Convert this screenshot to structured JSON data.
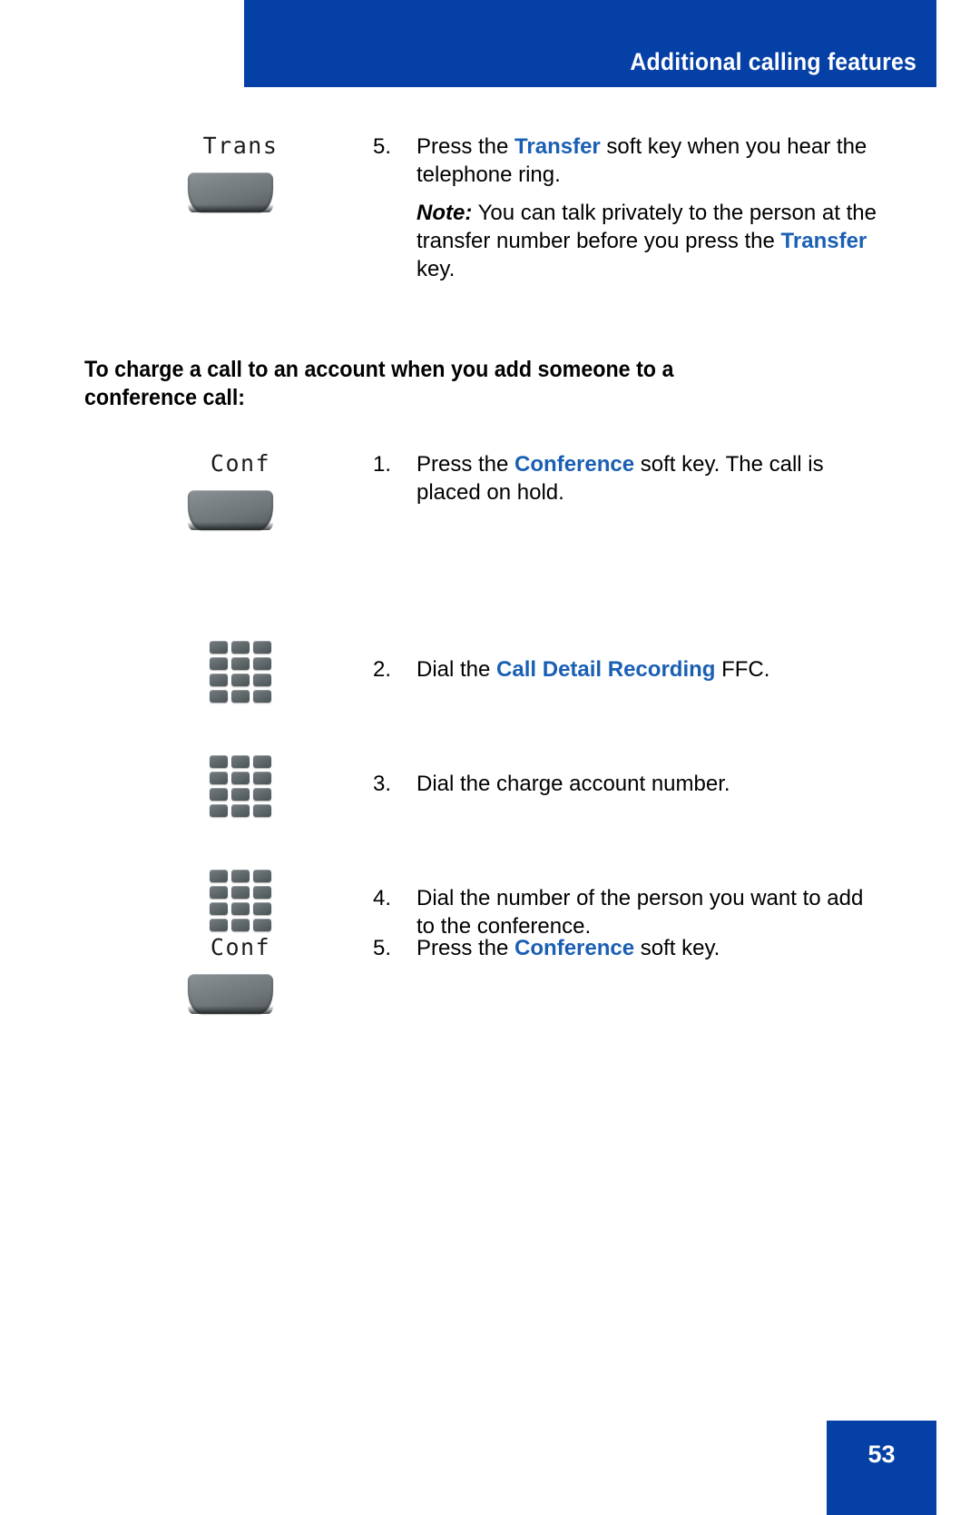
{
  "header": {
    "title": "Additional calling features",
    "background_color": "#0540a6",
    "text_color": "#ffffff"
  },
  "accent_color": "#1a5fb4",
  "continued_step": {
    "icon": {
      "type": "softkey",
      "label": "Trans"
    },
    "number": "5.",
    "text_before": "Press the ",
    "keyword": "Transfer",
    "text_after": " soft key when you hear the telephone ring.",
    "note": {
      "lead": "Note:",
      "text_before": " You can talk privately to the person at the transfer number before you press the ",
      "keyword": "Transfer",
      "text_after": " key."
    }
  },
  "section_heading": "To charge a call to an account when you add someone to a conference call:",
  "steps": [
    {
      "icon": {
        "type": "softkey",
        "label": "Conf"
      },
      "number": "1.",
      "text_before": "Press the ",
      "keyword": "Conference",
      "text_after": " soft key. The call is placed on hold."
    },
    {
      "icon": {
        "type": "keypad",
        "label": ""
      },
      "number": "2.",
      "text_before": "Dial the ",
      "keyword": "Call Detail Recording",
      "text_after": " FFC."
    },
    {
      "icon": {
        "type": "keypad",
        "label": ""
      },
      "number": "3.",
      "text_before": "Dial the charge account number.",
      "keyword": "",
      "text_after": ""
    },
    {
      "icon": {
        "type": "keypad",
        "label": ""
      },
      "number": "4.",
      "text_before": "Dial the number of the person you want to add to the conference.",
      "keyword": "",
      "text_after": ""
    },
    {
      "icon": {
        "type": "softkey",
        "label": "Conf"
      },
      "number": "5.",
      "text_before": "Press the ",
      "keyword": "Conference",
      "text_after": " soft key."
    }
  ],
  "footer": {
    "page_number": "53",
    "background_color": "#0540a6"
  }
}
